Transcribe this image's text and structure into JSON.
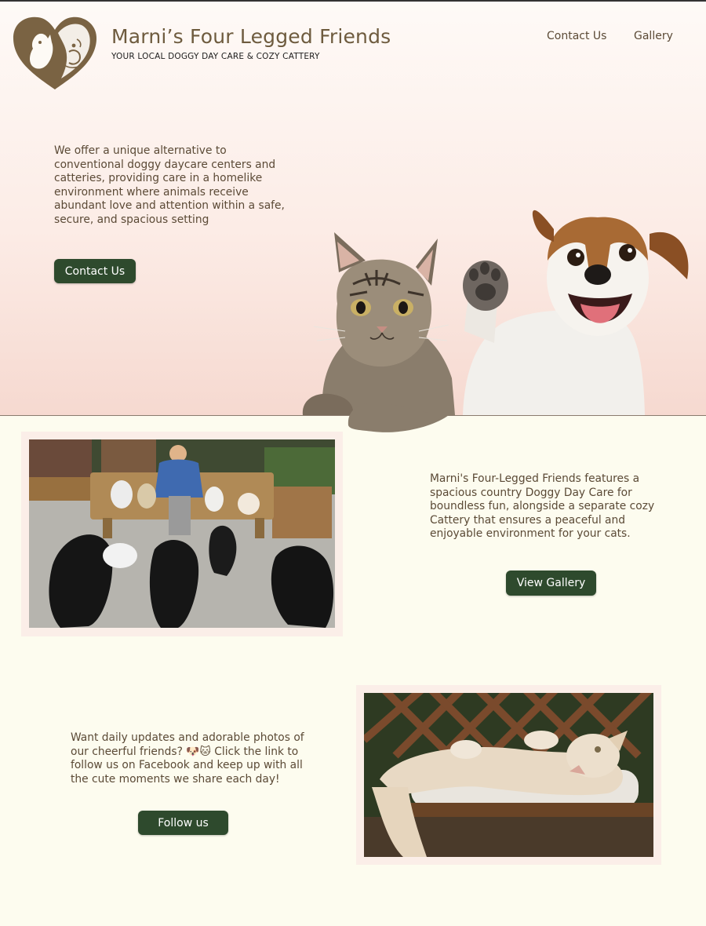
{
  "brand": {
    "title": "Marni’s Four Legged Friends",
    "tagline": "YOUR LOCAL DOGGY DAY CARE & COZY CATTERY"
  },
  "nav": {
    "contact": "Contact Us",
    "gallery": "Gallery"
  },
  "hero": {
    "text": "We offer a unique alternative to conventional doggy daycare centers and catteries, providing care in a homelike environment where animals receive abundant love and attention within a safe, secure, and spacious setting",
    "button": "Contact Us"
  },
  "section_daycare": {
    "text": "Marni's Four-Legged Friends features a spacious country Doggy Day Care for boundless fun, alongside a separate cozy Cattery that ensures a peaceful and enjoyable environment for your cats.",
    "button": "View Gallery"
  },
  "section_social": {
    "text": "Want daily updates and adorable photos of our cheerful friends? 🐶🐱 Click the link to follow us on Facebook and keep up with all the cute moments we share each day!",
    "button": "Follow us"
  },
  "colors": {
    "accent_button": "#2e4a2d",
    "brand_brown": "#6e5b3e",
    "body_text": "#5b4a36",
    "page_background": "#fdfcef",
    "hero_gradient_bottom": "#f6d9d0"
  }
}
